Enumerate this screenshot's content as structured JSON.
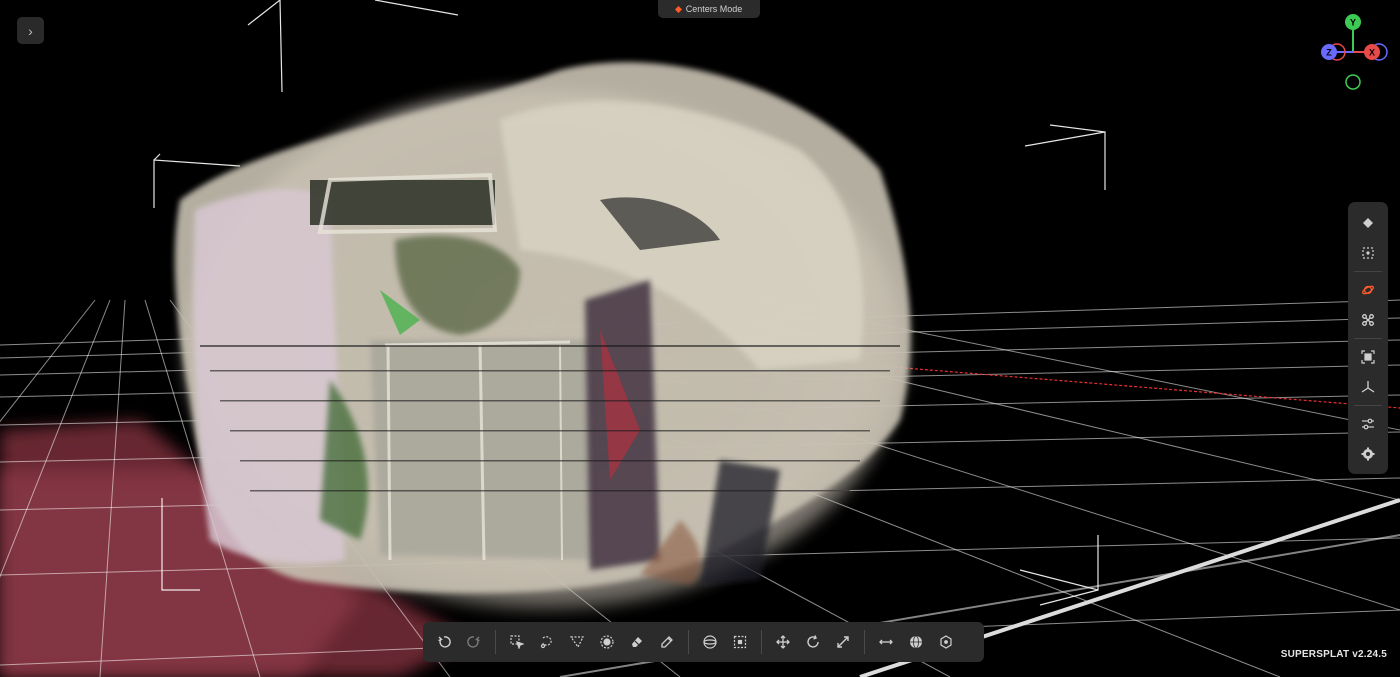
{
  "app": {
    "version_label": "SUPERSPLAT v2.24.5"
  },
  "mode_indicator": {
    "label": "Centers Mode",
    "dot_color": "#ff5a2a"
  },
  "gizmo": {
    "y_label": "Y",
    "x_label": "X",
    "z_label": "Z",
    "y_color": "#3ecb54",
    "x_color": "#e84a4a",
    "z_color": "#6a6aff"
  },
  "right_toolbar": {
    "items": [
      {
        "icon": "diamond-icon"
      },
      {
        "icon": "frame-select-icon"
      },
      {
        "icon": "orbit-icon",
        "active": true
      },
      {
        "icon": "fly-icon"
      },
      {
        "icon": "bound-box-icon"
      },
      {
        "icon": "axes-icon"
      },
      {
        "icon": "sliders-icon"
      },
      {
        "icon": "gear-icon"
      }
    ]
  },
  "bottom_toolbar": {
    "groups": [
      [
        "undo-icon",
        "redo-icon"
      ],
      [
        "picker-icon",
        "lasso-icon",
        "polygon-icon",
        "brush-icon",
        "eraser-icon",
        "eyedropper-icon"
      ],
      [
        "sphere-select-icon",
        "box-select-icon"
      ],
      [
        "move-icon",
        "rotate-icon",
        "scale-icon"
      ],
      [
        "local-space-icon",
        "globe-icon",
        "pivot-icon"
      ]
    ]
  },
  "colors": {
    "accent": "#ff5a2a",
    "panel": "#2b2b2b",
    "grid": "#ffffff",
    "x_axis": "#e83030"
  }
}
